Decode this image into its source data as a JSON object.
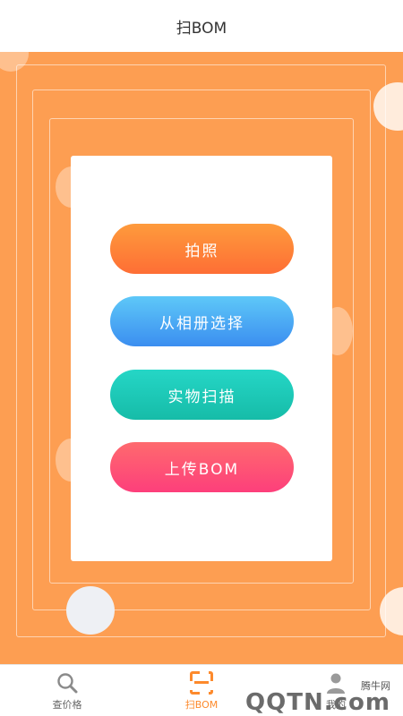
{
  "header": {
    "title": "扫BOM"
  },
  "actions": {
    "photo_label": "拍照",
    "album_label": "从相册选择",
    "scan_label": "实物扫描",
    "upload_label": "上传BOM"
  },
  "tabbar": {
    "tabs": [
      {
        "label": "查价格",
        "icon": "search-icon",
        "active": false
      },
      {
        "label": "扫BOM",
        "icon": "scan-icon",
        "active": true
      },
      {
        "label": "我的",
        "icon": "user-icon",
        "active": false
      }
    ]
  },
  "watermark": {
    "site_name": "腾牛网",
    "logo": "QQTN.com"
  },
  "colors": {
    "accent": "#fd9e52",
    "tab_active": "#fd8a2c",
    "btn_photo": "#fe7a38",
    "btn_album": "#4aa6f4",
    "btn_scan": "#1ec9b6",
    "btn_upload": "#fd4e76"
  }
}
